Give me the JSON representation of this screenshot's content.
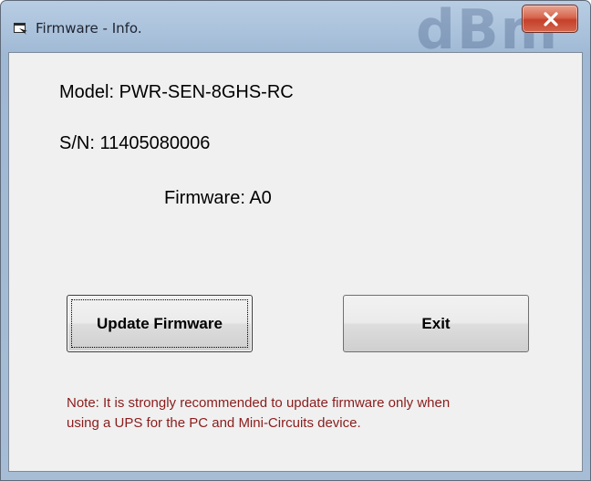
{
  "window": {
    "title": "Firmware - Info.",
    "watermark": "dBm"
  },
  "info": {
    "model": "Model: PWR-SEN-8GHS-RC",
    "serial": "S/N: 11405080006",
    "firmware": "Firmware: A0"
  },
  "buttons": {
    "update_label": "Update Firmware",
    "exit_label": "Exit"
  },
  "note": {
    "line1": "Note: It is strongly recommended to update firmware only when",
    "line2": "using a UPS for the PC and Mini-Circuits device."
  },
  "colors": {
    "note_text": "#8b1c1c",
    "close_button": "#c6402a",
    "dialog_background": "#f0f0f0"
  },
  "icons": [
    "app-window-icon",
    "close-icon"
  ]
}
